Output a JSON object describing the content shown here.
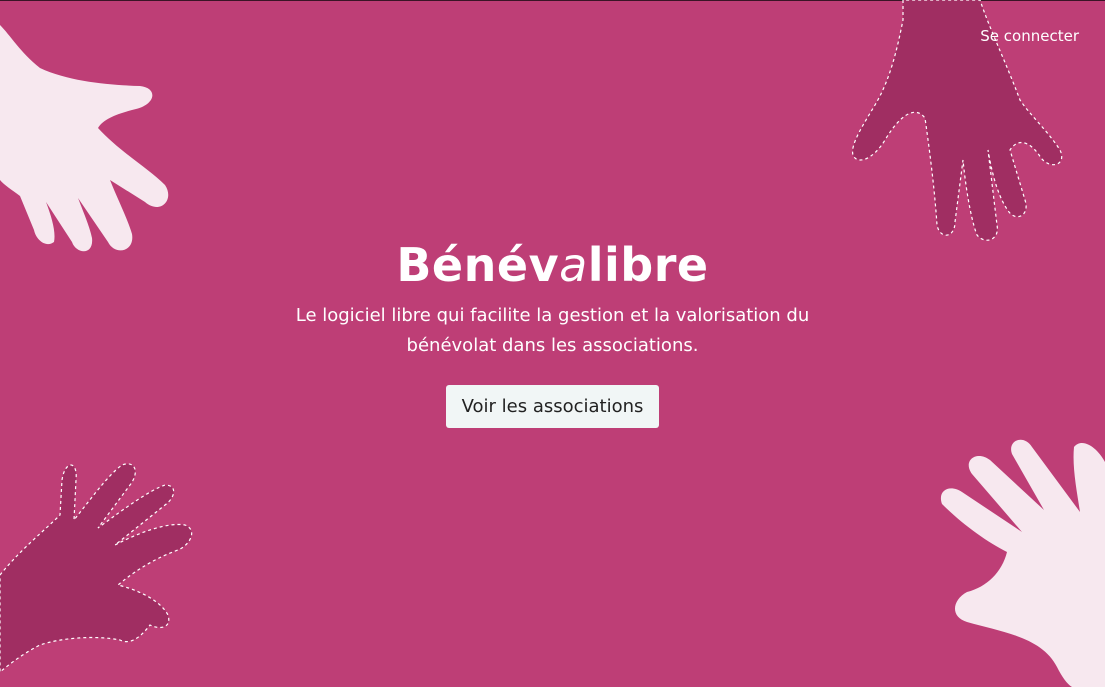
{
  "header": {
    "login_label": "Se connecter"
  },
  "hero": {
    "brand_part1": "Bénév",
    "brand_accent": "a",
    "brand_part2": "libre",
    "tagline": "Le logiciel libre qui facilite la gestion et la valorisation du bénévolat dans les associations.",
    "cta_label": "Voir les associations"
  },
  "decorations": {
    "hands": [
      "hand-top-left",
      "hand-top-right",
      "hand-bottom-left",
      "hand-bottom-right"
    ]
  },
  "colors": {
    "background": "#BE3E76",
    "light_hand": "#F7E8EF",
    "dark_hand": "#A02E62",
    "button_bg": "#F1F6F6",
    "text": "#FFFFFF"
  }
}
